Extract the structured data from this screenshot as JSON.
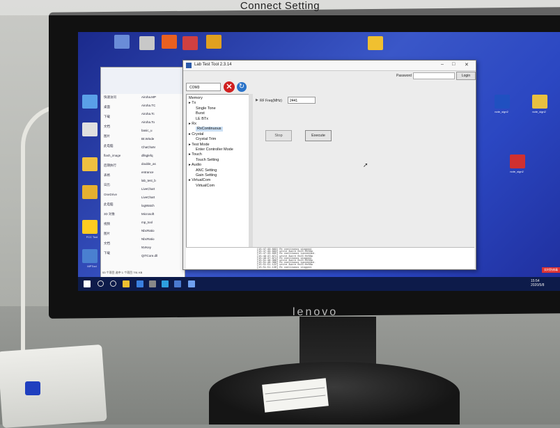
{
  "caption": "Connect Setting",
  "monitor_brand": "lenovo",
  "sticker_text": "",
  "tool_window": {
    "title": "Lab Test Tool 2.3.14",
    "password_label": "Password",
    "login_label": "Login",
    "com_port": "COM3",
    "freq_label": "RF Freq(MHz)",
    "freq_value": "2441",
    "stop_label": "Stop",
    "execute_label": "Execute",
    "tree": [
      {
        "label": "Memory",
        "indent": 0
      },
      {
        "label": "▸ Tx",
        "indent": 0
      },
      {
        "label": "Single Tone",
        "indent": 2
      },
      {
        "label": "Burst",
        "indent": 2
      },
      {
        "label": "LE BTx",
        "indent": 2
      },
      {
        "label": "▸ Rx",
        "indent": 0
      },
      {
        "label": "RxContinuous",
        "indent": 2,
        "selected": true
      },
      {
        "label": "▸ Crystal",
        "indent": 0
      },
      {
        "label": "Crystal Trim",
        "indent": 2
      },
      {
        "label": "▸ Test Mode",
        "indent": 0
      },
      {
        "label": "Enter Controller Mode",
        "indent": 2
      },
      {
        "label": "▸ Touch",
        "indent": 0
      },
      {
        "label": "Touch Setting",
        "indent": 2
      },
      {
        "label": "▸ Audio",
        "indent": 0
      },
      {
        "label": "ANC Setting",
        "indent": 2
      },
      {
        "label": "Gain Setting",
        "indent": 2
      },
      {
        "label": "▸ VirtualCom",
        "indent": 0
      },
      {
        "label": "VirtualCom",
        "indent": 2
      }
    ],
    "log_lines": [
      "[15:47:33.693] Rx continuous stopped.",
      "[15:47:33.693] write 3wire 0x2C:0x5Ba",
      "[15:47:33.695] Rx continuous succeeded.",
      "[15:49:37.871] write 3wire 0x2C:0x5Ba",
      "[15:49:37.871] Rx continuous stopped.",
      "[15:51:48.366] write 3wire 0x2C:0x5Ba",
      "[15:51:48.366] Rx continuous succeeded.",
      "[15:51:51.122] write 3wire 0x2C:0x5Ba",
      "[15:51:51.130] Rx continuous stopped."
    ]
  },
  "explorer": {
    "sidebar": [
      "快速访问",
      "桌面",
      "下载",
      "文档",
      "图片",
      "此电脑",
      "flash_image",
      "后期执行",
      "表格",
      "日历",
      "OneDrive",
      "此电脑",
      "3D 对象",
      "视频",
      "图片",
      "文档",
      "下载"
    ],
    "files": [
      "Airoha.MP",
      "Airoha.TC",
      "Airoha.Tc",
      "Airoha.To",
      "basic_u",
      "Bt.Winde",
      "ChaChaN",
      "dllsglefq",
      "double_as",
      "entrance",
      "lab_test_b",
      "LiveChart",
      "LiveChart",
      "logWatch",
      "Microsoft",
      "mp_tool",
      "NbcRatio",
      "NbcRatio",
      "NVKey",
      "QtTCore.dll"
    ],
    "status": "53 个项目   选中 1 个项目 791 KB"
  },
  "taskbar": {
    "time": "15:54",
    "date": "2020/5/8",
    "notification": "实时防病毒"
  },
  "desktop_icons_left": [
    "FCC Tool",
    "此电脑",
    "回收站",
    "MPTool"
  ],
  "desktop_icons_right": [
    "note_sign2",
    "note_sign2",
    "note_sign2"
  ]
}
